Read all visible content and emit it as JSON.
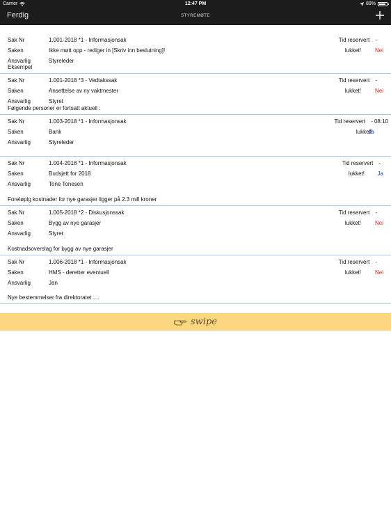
{
  "status_bar": {
    "carrier": "Carrier",
    "time": "12:47 PM",
    "battery": "89%",
    "battery_level": 0.89
  },
  "nav": {
    "done_label": "Ferdig",
    "title": "STYREMØTE"
  },
  "labels": {
    "sak_nr": "Sak Nr",
    "saken": "Saken",
    "ansvarlig": "Ansvarlig"
  },
  "items": [
    {
      "sak_nr": "1.001-2018  *1 - Informasjonsak",
      "saken": "Ikke møtt opp - rediger in  [Skriv inn beslutning]!",
      "ansvarlig": "Styreleder",
      "tid_label": "Tid reservert",
      "tid_value": "-",
      "lukket_label": "lukket!",
      "lukket_value": "Nei",
      "note": "Eksempel"
    },
    {
      "sak_nr": "1.001-2018  *3 - Vedtakssak",
      "saken": "Ansettelse av ny vaktmester",
      "ansvarlig": "Styret",
      "tid_label": "Tid reservert",
      "tid_value": "-",
      "lukket_label": "lukket!",
      "lukket_value": "Nei",
      "note": "Følgende personer er fortsatt aktuell :"
    },
    {
      "sak_nr": "1.003-2018  *1 - Informasjonsak",
      "saken": "Bank",
      "ansvarlig": "Styreleder",
      "tid_label": "Tid reservert",
      "tid_value": "- 08:10",
      "lukket_label": "lukket!",
      "lukket_value": "Ja",
      "note": ""
    },
    {
      "sak_nr": "1.004-2018  *1 - Informasjonsak",
      "saken": "Budsjett for 2018",
      "ansvarlig": "Tone Tonesen",
      "tid_label": "Tid reservert",
      "tid_value": "-",
      "lukket_label": "lukket!",
      "lukket_value": "Ja",
      "note": "Foreløpig kostnader for nye garasjer ligger på 2.3 mill kroner"
    },
    {
      "sak_nr": "1.005-2018  *2 - Diskusjonssak",
      "saken": "Bygg av nye garasjer",
      "ansvarlig": "Styret",
      "tid_label": "Tid reservert",
      "tid_value": "-",
      "lukket_label": "lukket!",
      "lukket_value": "Nei",
      "note": "Kostnadsoverslag for bygg av nye garasjer"
    },
    {
      "sak_nr": "1.006-2018  *1 - Informasjonsak",
      "saken": "HMS - deretter eventuell",
      "ansvarlig": "Jan",
      "tid_label": "Tid reservert",
      "tid_value": "-",
      "lukket_label": "lukket!",
      "lukket_value": "Nei",
      "note": "Nye bestemmelser fra direktoratet ...."
    }
  ],
  "swipe": {
    "label": "swipe"
  },
  "colors": {
    "bar": "#1c1c1c",
    "nei": "#e02020",
    "ja": "#1f3fd6",
    "divider": "#a9c8e8",
    "swipe_bg": "#fcd77f"
  }
}
